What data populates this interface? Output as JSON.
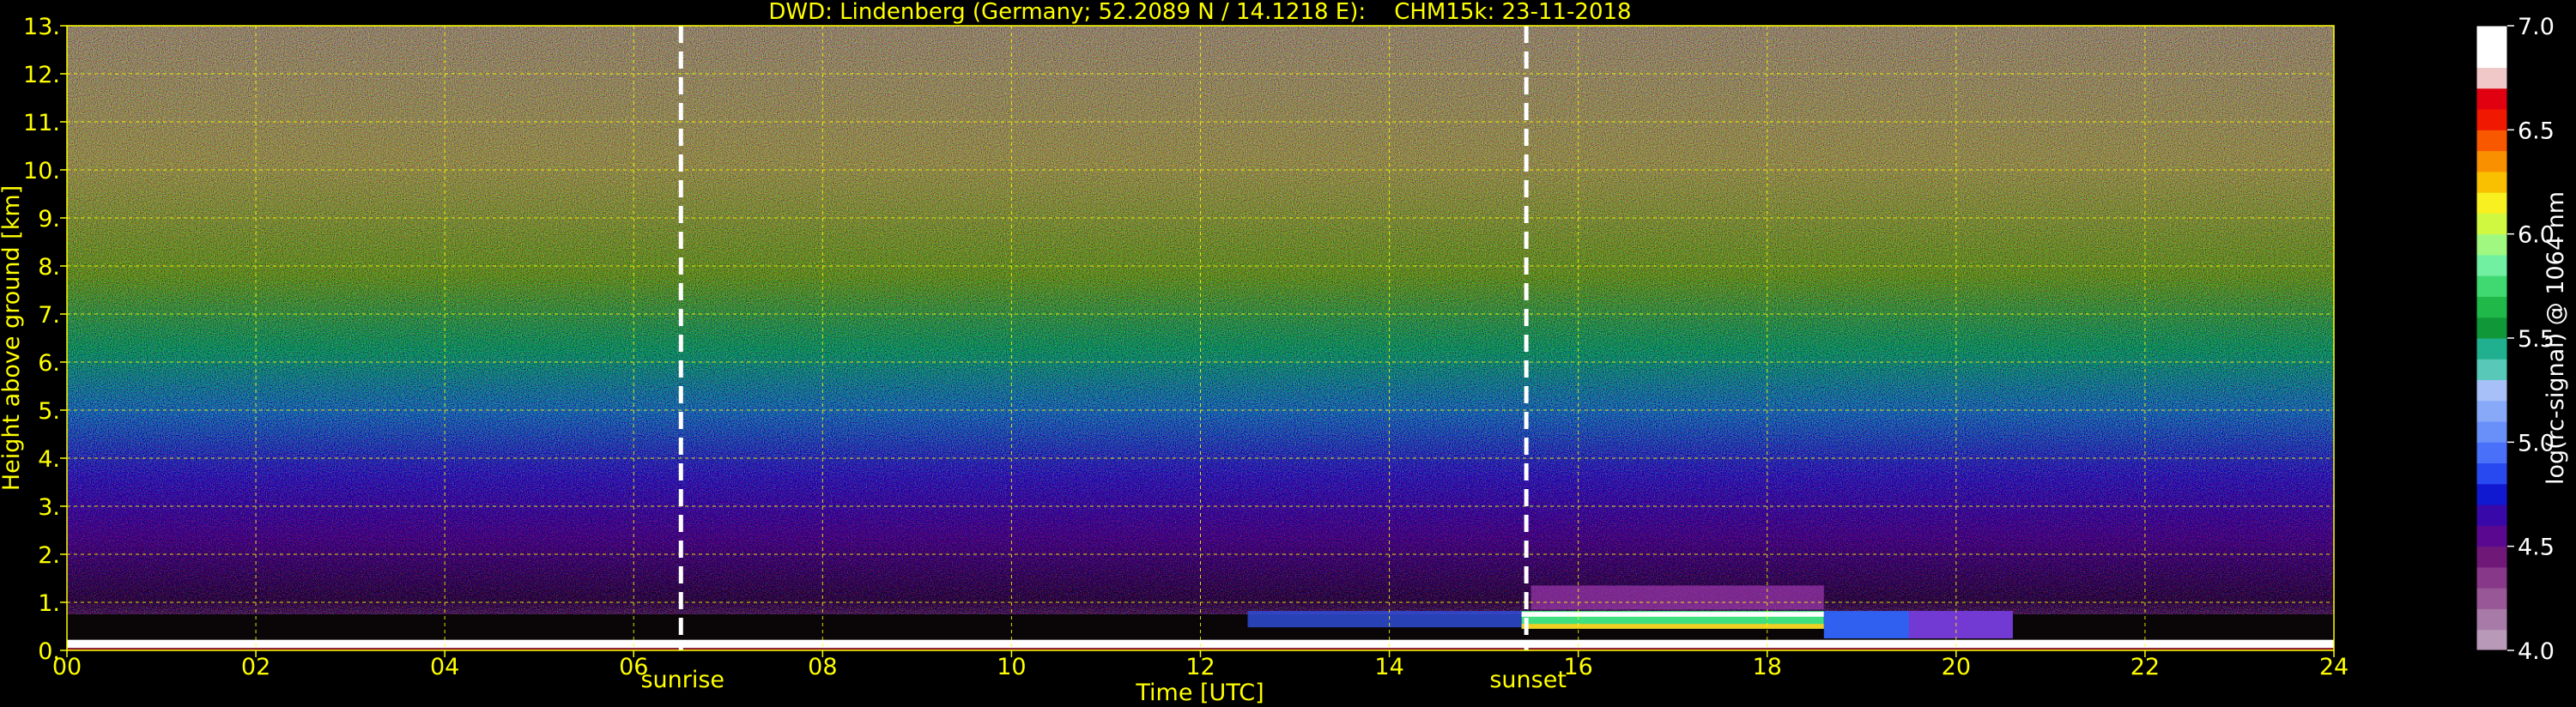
{
  "chart_data": {
    "type": "heatmap",
    "title": "DWD: Lindenberg (Germany; 52.2089 N / 14.1218 E):    CHM15k: 23-11-2018",
    "xlabel": "Time [UTC]",
    "ylabel": "Height above ground [km]",
    "xlim": [
      0,
      24
    ],
    "ylim": [
      0,
      13
    ],
    "x_ticks": [
      0,
      2,
      4,
      6,
      8,
      10,
      12,
      14,
      16,
      18,
      20,
      22,
      24
    ],
    "x_tick_labels": [
      "00",
      "02",
      "04",
      "06",
      "08",
      "10",
      "12",
      "14",
      "16",
      "18",
      "20",
      "22",
      "24"
    ],
    "y_ticks": [
      0,
      1,
      2,
      3,
      4,
      5,
      6,
      7,
      8,
      9,
      10,
      11,
      12,
      13
    ],
    "y_tick_labels": [
      "0.",
      "1.",
      "2.",
      "3.",
      "4.",
      "5.",
      "6.",
      "7.",
      "8.",
      "9.",
      "10.",
      "11.",
      "12.",
      "13."
    ],
    "grid": true,
    "annotations": [
      {
        "x": 6.5,
        "text": "sunrise"
      },
      {
        "x": 15.45,
        "text": "sunset"
      }
    ],
    "colorbar": {
      "label": "log(rc-signal) @ 1064 nm",
      "range": [
        4.0,
        7.0
      ],
      "ticks": [
        4.0,
        4.5,
        5.0,
        5.5,
        6.0,
        6.5,
        7.0
      ],
      "tick_labels": [
        "4.0",
        "4.5",
        "5.0",
        "5.5",
        "6.0",
        "6.5",
        "7.0"
      ],
      "colors": [
        "#b89ab8",
        "#a87aa8",
        "#985898",
        "#883888",
        "#701878",
        "#5a0890",
        "#3808a8",
        "#1018d0",
        "#2848f0",
        "#4870f8",
        "#6890f8",
        "#88a8f8",
        "#a8c0f8",
        "#58c8b8",
        "#20b090",
        "#109838",
        "#20b848",
        "#40d870",
        "#70f0a0",
        "#a0f880",
        "#d0f840",
        "#f8f020",
        "#f8c000",
        "#f89000",
        "#f85800",
        "#f01800",
        "#e00010",
        "#f0c8c8",
        "#ffffff",
        "#ffffff"
      ]
    },
    "colors": {
      "axis": "#ffff00",
      "grid": "#ffff00",
      "marker": "#ffffff",
      "background": "#000000"
    }
  }
}
